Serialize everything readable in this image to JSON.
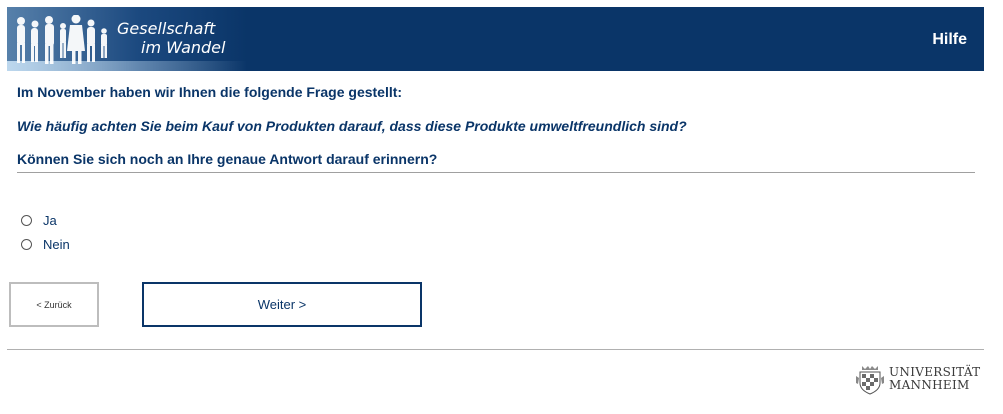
{
  "header": {
    "brand_line1": "Gesellschaft",
    "brand_line2": "im Wandel",
    "help_label": "Hilfe",
    "background_color": "#0a3568"
  },
  "content": {
    "intro": "Im November haben wir Ihnen die folgende Frage gestellt:",
    "question": "Wie häufig achten Sie beim Kauf von Produkten darauf, dass diese Produkte umweltfreundlich sind?",
    "followup": "Können Sie sich noch an Ihre genaue Antwort darauf erinnern?",
    "options": [
      {
        "label": "Ja",
        "selected": false
      },
      {
        "label": "Nein",
        "selected": false
      }
    ]
  },
  "nav": {
    "back_label": "< Zurück",
    "next_label": "Weiter >"
  },
  "footer": {
    "university_line1": "UNIVERSITÄT",
    "university_line2": "MANNHEIM"
  },
  "colors": {
    "primary": "#0a3568",
    "text": "#0a3568"
  }
}
